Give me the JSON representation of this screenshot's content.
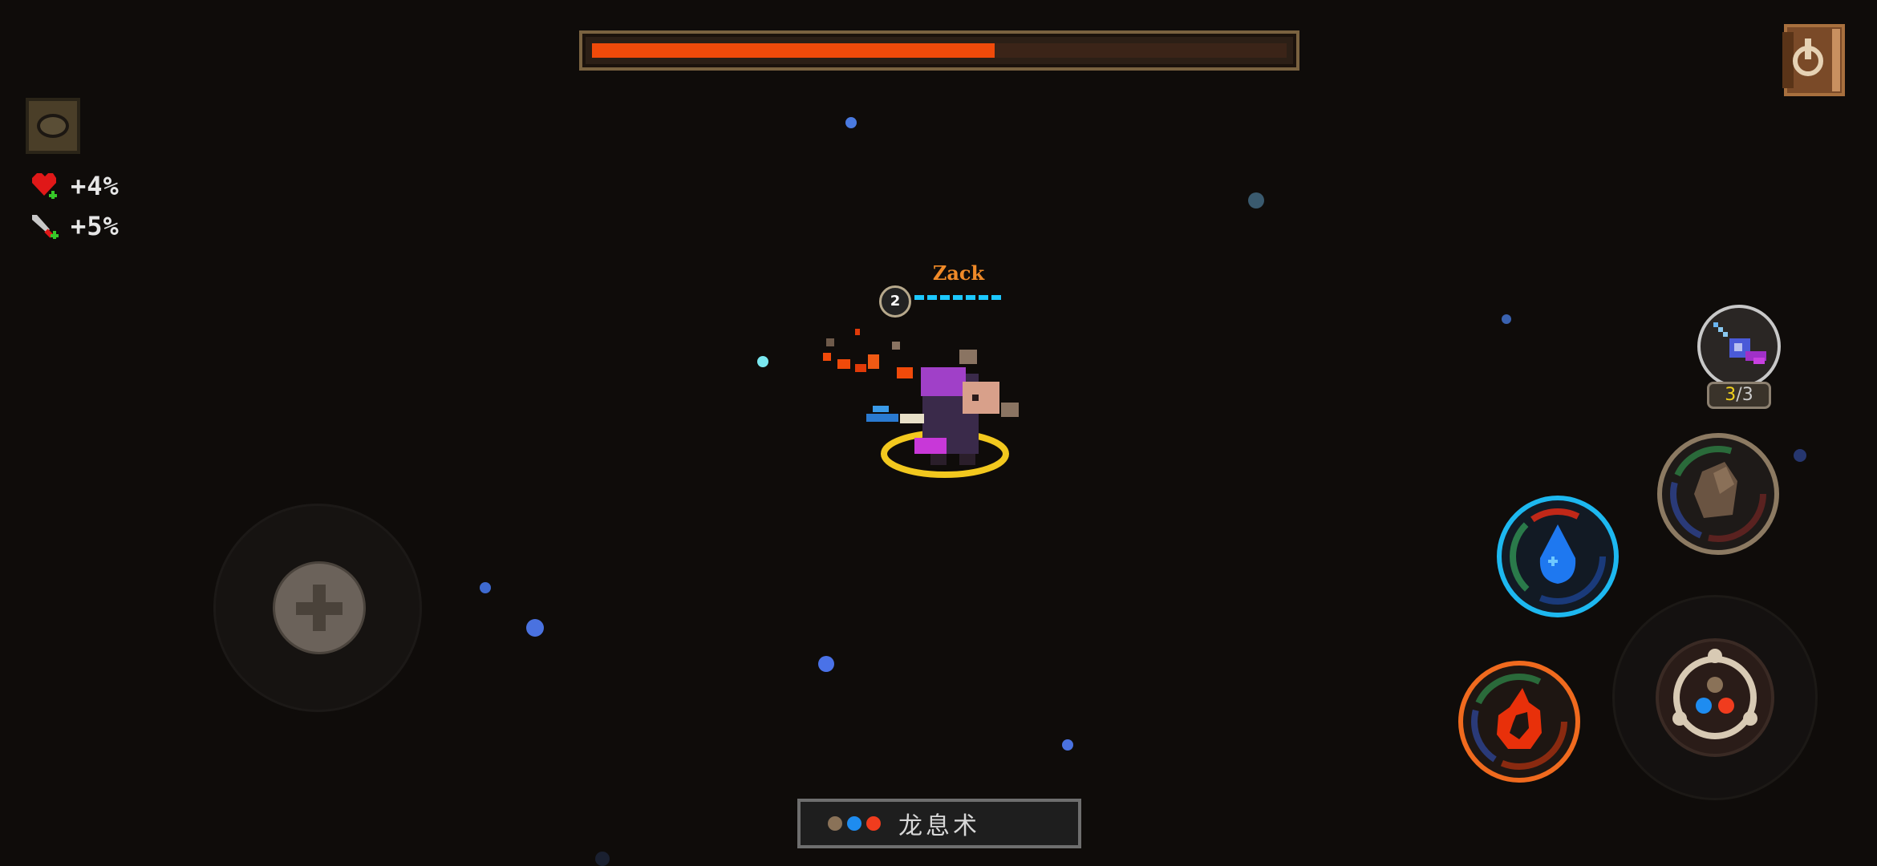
{
  "boss": {
    "health_fraction": 0.58,
    "bar_color": "#f04a0a"
  },
  "buffs": [
    {
      "icon": "heart-up-icon",
      "text": "+4%"
    },
    {
      "icon": "sword-up-icon",
      "text": "+5%"
    }
  ],
  "player": {
    "name": "Zack",
    "level": "2",
    "mana_pips_total": 7,
    "mana_pips_filled": 7
  },
  "weapon_slot": {
    "icon": "staff-wand-icon",
    "ammo_current": "3",
    "ammo_separator": "/",
    "ammo_max": "3"
  },
  "skills": [
    {
      "name": "earth-skill",
      "icon": "rock-icon",
      "ring_color": "#8c7a62"
    },
    {
      "name": "water-skill",
      "icon": "water-drop-icon",
      "ring_color": "#1db8f0"
    },
    {
      "name": "fire-skill",
      "icon": "flame-icon",
      "ring_color": "#f06a1e"
    },
    {
      "name": "combine-skill",
      "icon": "element-combine-icon",
      "ring_color": "#b0a090"
    }
  ],
  "element_combo": {
    "orbs": [
      "#8a7258",
      "#1e8cf0",
      "#f03c1e"
    ],
    "spell_name": "龙息术"
  },
  "colors": {
    "background": "#0f0c0a",
    "accent_gold": "#f2c81e",
    "player_name": "#f08a28"
  }
}
